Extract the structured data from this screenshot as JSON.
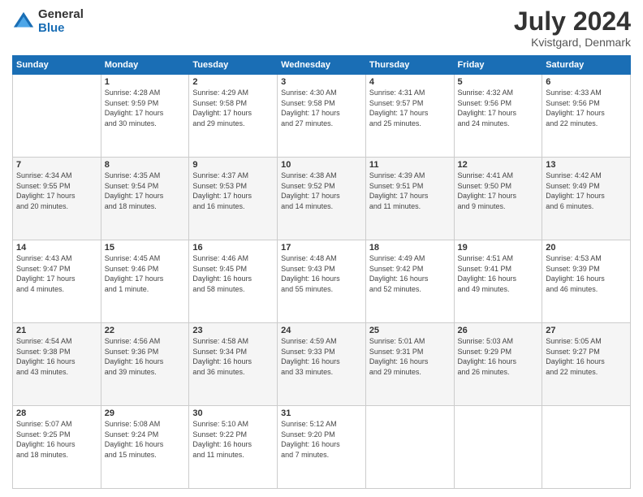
{
  "header": {
    "logo_general": "General",
    "logo_blue": "Blue",
    "month_title": "July 2024",
    "location": "Kvistgard, Denmark"
  },
  "days_of_week": [
    "Sunday",
    "Monday",
    "Tuesday",
    "Wednesday",
    "Thursday",
    "Friday",
    "Saturday"
  ],
  "weeks": [
    [
      {
        "day": "",
        "content": ""
      },
      {
        "day": "1",
        "content": "Sunrise: 4:28 AM\nSunset: 9:59 PM\nDaylight: 17 hours\nand 30 minutes."
      },
      {
        "day": "2",
        "content": "Sunrise: 4:29 AM\nSunset: 9:58 PM\nDaylight: 17 hours\nand 29 minutes."
      },
      {
        "day": "3",
        "content": "Sunrise: 4:30 AM\nSunset: 9:58 PM\nDaylight: 17 hours\nand 27 minutes."
      },
      {
        "day": "4",
        "content": "Sunrise: 4:31 AM\nSunset: 9:57 PM\nDaylight: 17 hours\nand 25 minutes."
      },
      {
        "day": "5",
        "content": "Sunrise: 4:32 AM\nSunset: 9:56 PM\nDaylight: 17 hours\nand 24 minutes."
      },
      {
        "day": "6",
        "content": "Sunrise: 4:33 AM\nSunset: 9:56 PM\nDaylight: 17 hours\nand 22 minutes."
      }
    ],
    [
      {
        "day": "7",
        "content": "Sunrise: 4:34 AM\nSunset: 9:55 PM\nDaylight: 17 hours\nand 20 minutes."
      },
      {
        "day": "8",
        "content": "Sunrise: 4:35 AM\nSunset: 9:54 PM\nDaylight: 17 hours\nand 18 minutes."
      },
      {
        "day": "9",
        "content": "Sunrise: 4:37 AM\nSunset: 9:53 PM\nDaylight: 17 hours\nand 16 minutes."
      },
      {
        "day": "10",
        "content": "Sunrise: 4:38 AM\nSunset: 9:52 PM\nDaylight: 17 hours\nand 14 minutes."
      },
      {
        "day": "11",
        "content": "Sunrise: 4:39 AM\nSunset: 9:51 PM\nDaylight: 17 hours\nand 11 minutes."
      },
      {
        "day": "12",
        "content": "Sunrise: 4:41 AM\nSunset: 9:50 PM\nDaylight: 17 hours\nand 9 minutes."
      },
      {
        "day": "13",
        "content": "Sunrise: 4:42 AM\nSunset: 9:49 PM\nDaylight: 17 hours\nand 6 minutes."
      }
    ],
    [
      {
        "day": "14",
        "content": "Sunrise: 4:43 AM\nSunset: 9:47 PM\nDaylight: 17 hours\nand 4 minutes."
      },
      {
        "day": "15",
        "content": "Sunrise: 4:45 AM\nSunset: 9:46 PM\nDaylight: 17 hours\nand 1 minute."
      },
      {
        "day": "16",
        "content": "Sunrise: 4:46 AM\nSunset: 9:45 PM\nDaylight: 16 hours\nand 58 minutes."
      },
      {
        "day": "17",
        "content": "Sunrise: 4:48 AM\nSunset: 9:43 PM\nDaylight: 16 hours\nand 55 minutes."
      },
      {
        "day": "18",
        "content": "Sunrise: 4:49 AM\nSunset: 9:42 PM\nDaylight: 16 hours\nand 52 minutes."
      },
      {
        "day": "19",
        "content": "Sunrise: 4:51 AM\nSunset: 9:41 PM\nDaylight: 16 hours\nand 49 minutes."
      },
      {
        "day": "20",
        "content": "Sunrise: 4:53 AM\nSunset: 9:39 PM\nDaylight: 16 hours\nand 46 minutes."
      }
    ],
    [
      {
        "day": "21",
        "content": "Sunrise: 4:54 AM\nSunset: 9:38 PM\nDaylight: 16 hours\nand 43 minutes."
      },
      {
        "day": "22",
        "content": "Sunrise: 4:56 AM\nSunset: 9:36 PM\nDaylight: 16 hours\nand 39 minutes."
      },
      {
        "day": "23",
        "content": "Sunrise: 4:58 AM\nSunset: 9:34 PM\nDaylight: 16 hours\nand 36 minutes."
      },
      {
        "day": "24",
        "content": "Sunrise: 4:59 AM\nSunset: 9:33 PM\nDaylight: 16 hours\nand 33 minutes."
      },
      {
        "day": "25",
        "content": "Sunrise: 5:01 AM\nSunset: 9:31 PM\nDaylight: 16 hours\nand 29 minutes."
      },
      {
        "day": "26",
        "content": "Sunrise: 5:03 AM\nSunset: 9:29 PM\nDaylight: 16 hours\nand 26 minutes."
      },
      {
        "day": "27",
        "content": "Sunrise: 5:05 AM\nSunset: 9:27 PM\nDaylight: 16 hours\nand 22 minutes."
      }
    ],
    [
      {
        "day": "28",
        "content": "Sunrise: 5:07 AM\nSunset: 9:25 PM\nDaylight: 16 hours\nand 18 minutes."
      },
      {
        "day": "29",
        "content": "Sunrise: 5:08 AM\nSunset: 9:24 PM\nDaylight: 16 hours\nand 15 minutes."
      },
      {
        "day": "30",
        "content": "Sunrise: 5:10 AM\nSunset: 9:22 PM\nDaylight: 16 hours\nand 11 minutes."
      },
      {
        "day": "31",
        "content": "Sunrise: 5:12 AM\nSunset: 9:20 PM\nDaylight: 16 hours\nand 7 minutes."
      },
      {
        "day": "",
        "content": ""
      },
      {
        "day": "",
        "content": ""
      },
      {
        "day": "",
        "content": ""
      }
    ]
  ]
}
